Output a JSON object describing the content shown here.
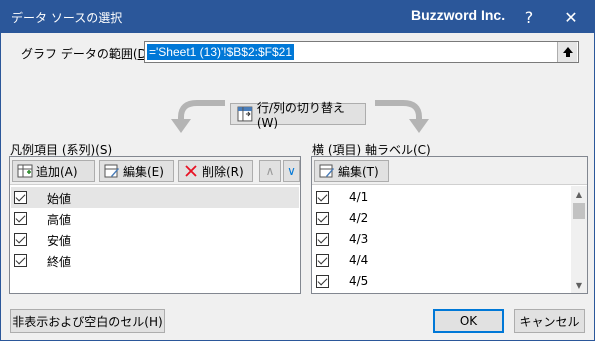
{
  "window": {
    "title": "データ ソースの選択",
    "brand": "Buzzword Inc.",
    "help_label": "?",
    "close_label": "✕"
  },
  "range": {
    "label_pre": "グラフ データの範囲(",
    "label_key": "D",
    "label_post": "):",
    "value": "='Sheet1 (13)'!$B$2:$F$21",
    "collapse_label": "⬆"
  },
  "switch_button": {
    "label": "行/列の切り替え(W)"
  },
  "legend_panel": {
    "label": "凡例項目 (系列)(S)",
    "add_label": "追加(A)",
    "edit_label": "編集(E)",
    "delete_label": "削除(R)",
    "up_label": "∧",
    "down_label": "∨",
    "items": [
      {
        "label": "始値",
        "checked": true,
        "selected": true
      },
      {
        "label": "高値",
        "checked": true,
        "selected": false
      },
      {
        "label": "安値",
        "checked": true,
        "selected": false
      },
      {
        "label": "終値",
        "checked": true,
        "selected": false
      }
    ]
  },
  "axis_panel": {
    "label": "横 (項目) 軸ラベル(C)",
    "edit_label": "編集(T)",
    "items": [
      {
        "label": "4/1",
        "checked": true
      },
      {
        "label": "4/2",
        "checked": true
      },
      {
        "label": "4/3",
        "checked": true
      },
      {
        "label": "4/4",
        "checked": true
      },
      {
        "label": "4/5",
        "checked": true
      }
    ]
  },
  "footer": {
    "hidden_cells_label": "非表示および空白のセル(H)",
    "ok_label": "OK",
    "cancel_label": "キャンセル"
  },
  "colors": {
    "titlebar": "#2b579a",
    "selection": "#0078d7",
    "delete_icon": "#e81123"
  },
  "icons": {
    "add": "add-table-icon",
    "edit": "edit-icon",
    "delete": "delete-x-icon",
    "switch": "switch-row-column-icon"
  }
}
